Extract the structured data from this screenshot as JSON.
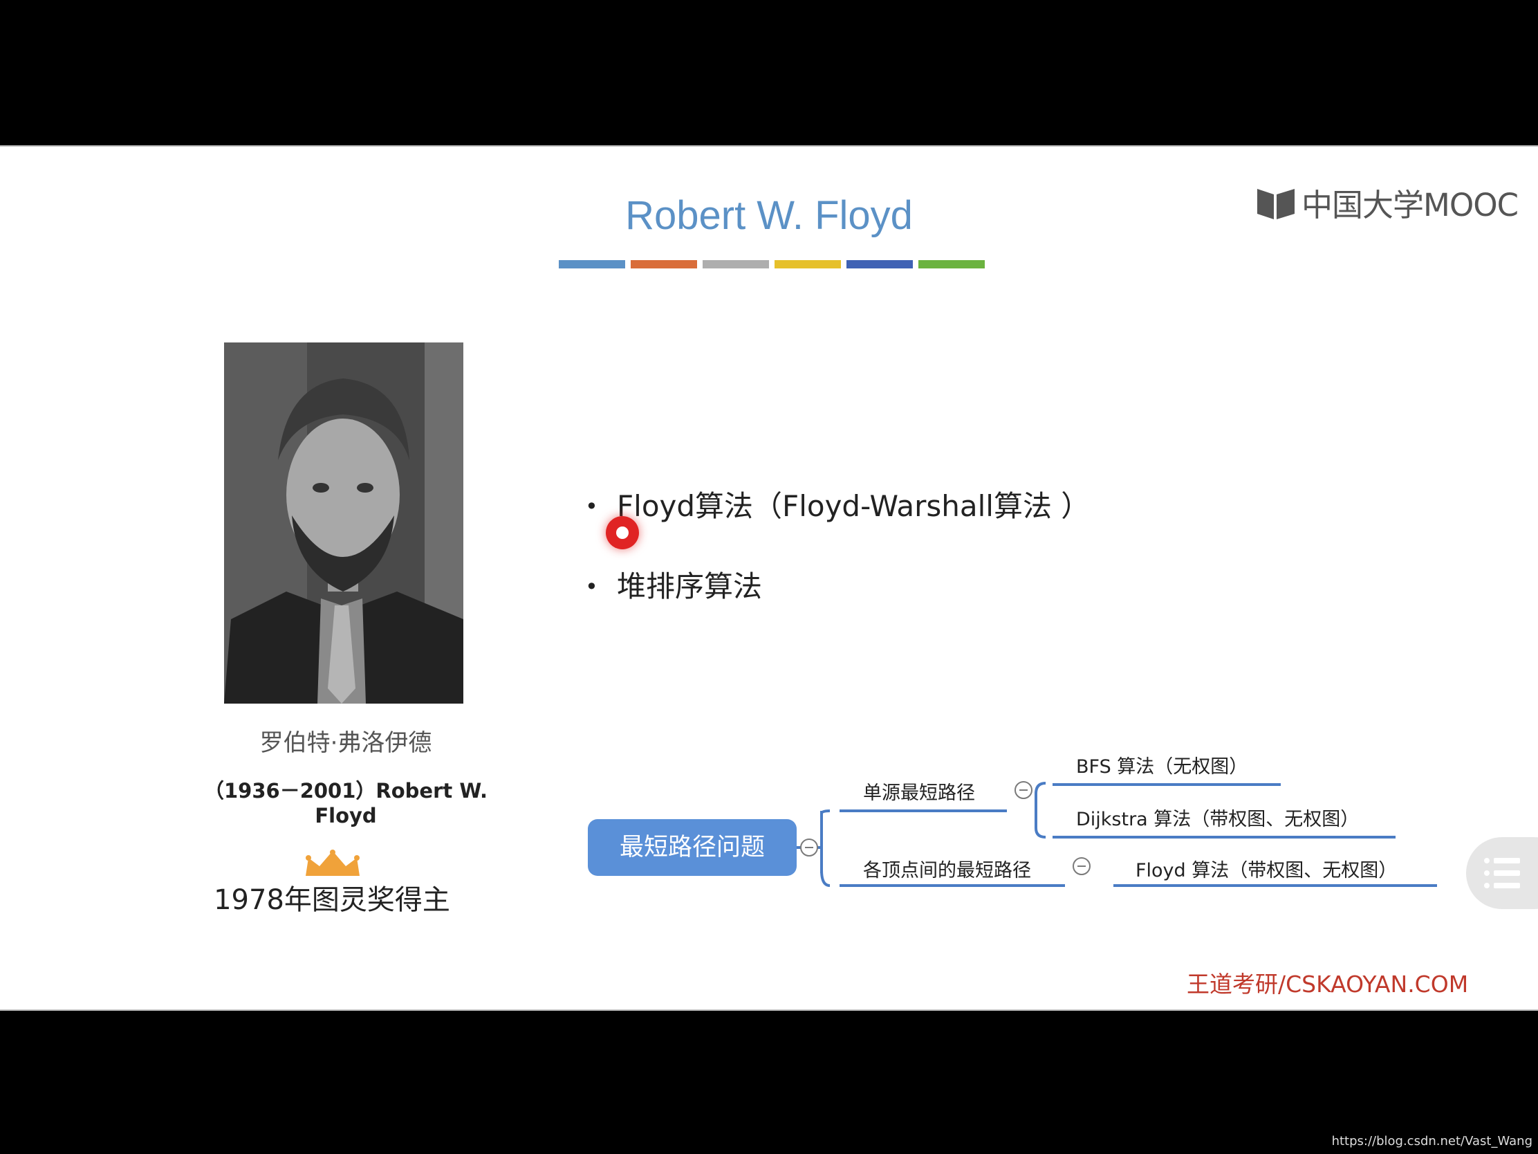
{
  "slide": {
    "title": "Robert W.  Floyd",
    "color_bar": [
      "#5b91c6",
      "#d96d3a",
      "#aeaeae",
      "#e6c02b",
      "#3f62b4",
      "#6bb33f"
    ],
    "logo_text": "中国大学MOOC",
    "portrait": {
      "name_cn": "罗伯特·弗洛伊德",
      "name_en": "（1936－2001）Robert W.  Floyd",
      "award": "1978年图灵奖得主"
    },
    "bullets": [
      "Floyd算法（Floyd-Warshall算法 ）",
      "堆排序算法"
    ],
    "mindmap": {
      "root": "最短路径问题",
      "branches": [
        {
          "label": "单源最短路径",
          "children": [
            "BFS 算法（无权图）",
            "Dijkstra 算法（带权图、无权图）"
          ]
        },
        {
          "label": "各顶点间的最短路径",
          "children": [
            "Floyd 算法（带权图、无权图）"
          ]
        }
      ]
    },
    "footer_brand": "王道考研/CSKAOYAN.COM"
  },
  "watermark": "https://blog.csdn.net/Vast_Wang",
  "colors": {
    "accent": "#5a90d8",
    "brand_red": "#c0392b",
    "cursor": "#e02424"
  }
}
